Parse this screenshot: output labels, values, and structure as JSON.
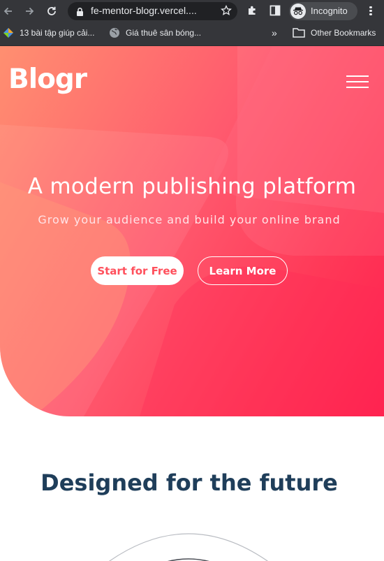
{
  "browser": {
    "url": "fe-mentor-blogr.vercel....",
    "profile_label": "Incognito",
    "icons": [
      "back-icon",
      "forward-icon",
      "reload-icon",
      "lock-icon",
      "star-icon",
      "extensions-icon",
      "side-panel-icon",
      "incognito-icon",
      "menu-icon"
    ],
    "bookmarks": [
      {
        "label": "13 bài tập giúp cải...",
        "icon": "bookmark-favicon-icon"
      },
      {
        "label": "Giá thuê sân bóng...",
        "icon": "globe-icon"
      }
    ],
    "more_label": "»",
    "other_bookmarks_label": "Other Bookmarks"
  },
  "page": {
    "logo": "Blogr",
    "hero": {
      "headline": "A modern publishing platform",
      "subheadline": "Grow your audience and build your online brand",
      "primary_button": "Start for Free",
      "secondary_button": "Learn More"
    },
    "section_title": "Designed for the future"
  },
  "colors": {
    "chrome_background": "#35363a",
    "omnibox_background": "#202124",
    "hero_gradient_start": "#ff8f70",
    "hero_gradient_end": "#ff1f4e",
    "primary_button_text": "#ff505c",
    "section_title": "#1f3e5a"
  }
}
